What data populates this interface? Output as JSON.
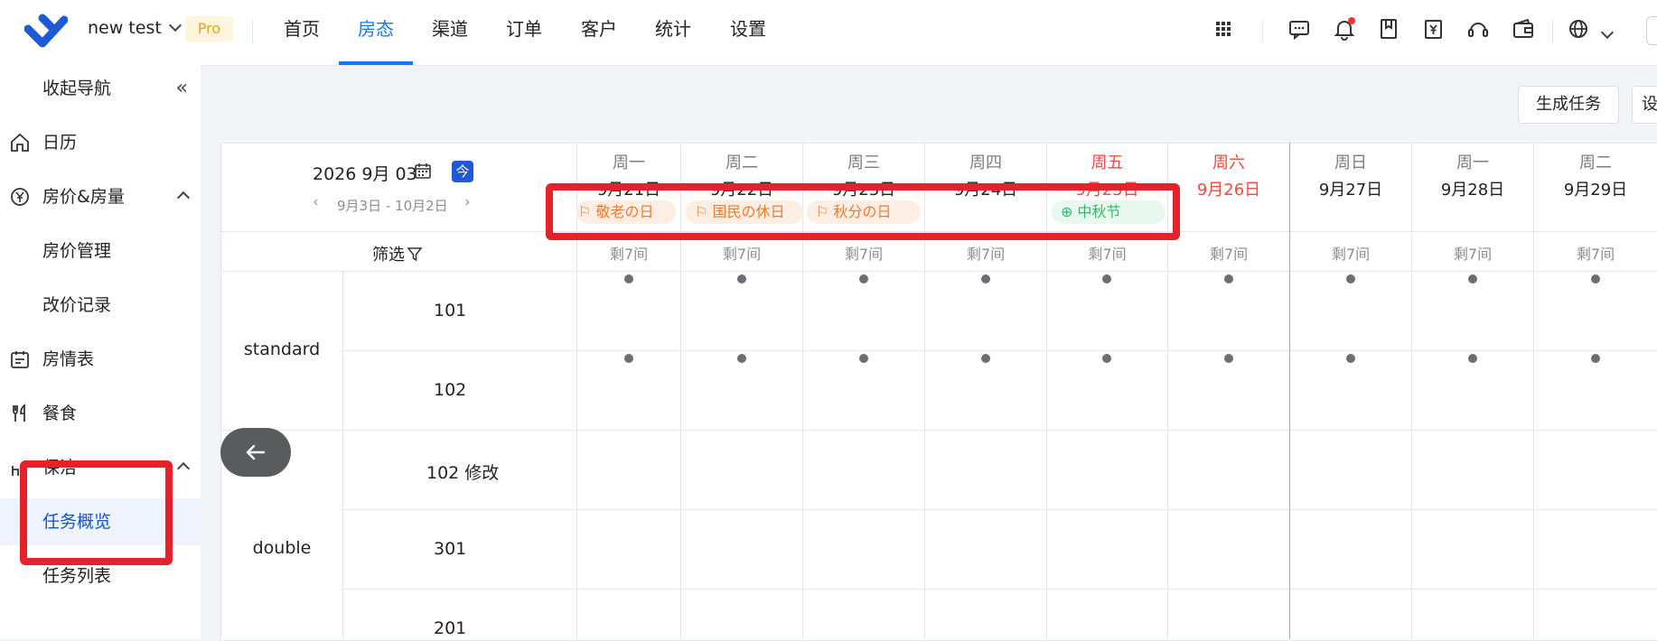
{
  "topbar": {
    "workspace": "new test",
    "badge": "Pro",
    "nav": [
      "首页",
      "房态",
      "渠道",
      "订单",
      "客户",
      "统计",
      "设置"
    ],
    "active_nav": "房态"
  },
  "sidebar": {
    "collapse_label": "收起导航",
    "items": [
      {
        "label": "日历",
        "icon": "home-icon"
      },
      {
        "label": "房价&房量",
        "icon": "yen-icon"
      },
      {
        "label": "房价管理"
      },
      {
        "label": "改价记录"
      },
      {
        "label": "房情表",
        "icon": "calendar-list-icon"
      },
      {
        "label": "餐食",
        "icon": "fork-knife-icon"
      },
      {
        "label": "保洁",
        "icon": "cleaning-icon"
      },
      {
        "label": "任务概览"
      },
      {
        "label": "任务列表"
      }
    ]
  },
  "actions": {
    "generate_task": "生成任务",
    "settings_partial": "设"
  },
  "calendar": {
    "date_label": "2026 9月 03",
    "today_label": "今",
    "range": "9月3日 - 10月2日",
    "filter_label": "筛选",
    "days": [
      {
        "weekday": "周一",
        "date": "9月21日"
      },
      {
        "weekday": "周二",
        "date": "9月22日"
      },
      {
        "weekday": "周三",
        "date": "9月23日"
      },
      {
        "weekday": "周四",
        "date": "9月24日"
      },
      {
        "weekday": "周五",
        "date": "9月25日"
      },
      {
        "weekday": "周六",
        "date": "9月26日"
      },
      {
        "weekday": "周日",
        "date": "9月27日"
      },
      {
        "weekday": "周一",
        "date": "9月28日"
      },
      {
        "weekday": "周二",
        "date": "9月29日"
      }
    ],
    "holidays": [
      "敬老の日",
      "国民の休日",
      "秋分の日",
      "中秋节"
    ],
    "remaining": [
      "剩7间",
      "剩7间",
      "剩7间",
      "剩7间",
      "剩7间",
      "剩7间",
      "剩7间",
      "剩7间",
      "剩7间"
    ],
    "room_types": [
      "standard",
      "double"
    ],
    "rooms": [
      "101",
      "102",
      "102 修改",
      "301",
      "201"
    ]
  },
  "colors": {
    "accent": "#1677ff",
    "weekend": "#ef4a3e",
    "highlight": "#e5222a"
  }
}
